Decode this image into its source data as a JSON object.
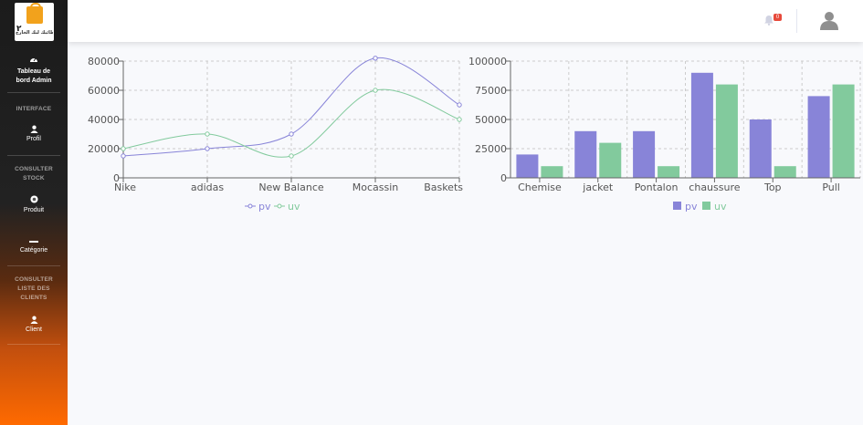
{
  "sidebar": {
    "logo_text": "فطائيك لبك الخارج",
    "logo_number": "٢",
    "dashboard_label": "Tableau de bord Admin",
    "interface_heading": "INTERFACE",
    "profil_label": "Profil",
    "consulter_stock_heading": "CONSULTER STOCK",
    "produit_label": "Produit",
    "categorie_label": "Catégorie",
    "consulter_clients_heading": "CONSULTER LISTE DES CLIENTS",
    "client_label": "Client"
  },
  "topbar": {
    "notification_count": "0",
    "icons": [
      "bell-icon",
      "user-avatar-icon"
    ]
  },
  "colors": {
    "pv": "#8884d8",
    "uv": "#82ca9d",
    "badge": "#e74a3b"
  },
  "chart_data": [
    {
      "type": "line",
      "categories": [
        "Nike",
        "adidas",
        "New Balance",
        "Mocassin",
        "Baskets"
      ],
      "series": [
        {
          "name": "pv",
          "values": [
            15000,
            20000,
            30000,
            82000,
            50000
          ]
        },
        {
          "name": "uv",
          "values": [
            20000,
            30000,
            15000,
            60000,
            40000
          ]
        }
      ],
      "ylim": [
        0,
        80000
      ],
      "yticks": [
        "0",
        "20000",
        "40000",
        "60000",
        "80000"
      ],
      "grid": true,
      "legend": "bottom"
    },
    {
      "type": "bar",
      "categories": [
        "Chemise",
        "jacket",
        "Pontalon",
        "chaussure",
        "Top",
        "Pull"
      ],
      "series": [
        {
          "name": "pv",
          "values": [
            20000,
            40000,
            40000,
            90000,
            50000,
            70000
          ]
        },
        {
          "name": "uv",
          "values": [
            10000,
            30000,
            10000,
            80000,
            10000,
            80000
          ]
        }
      ],
      "ylim": [
        0,
        100000
      ],
      "yticks": [
        "0",
        "25000",
        "50000",
        "75000",
        "100000"
      ],
      "grid": true,
      "legend": "bottom"
    }
  ]
}
